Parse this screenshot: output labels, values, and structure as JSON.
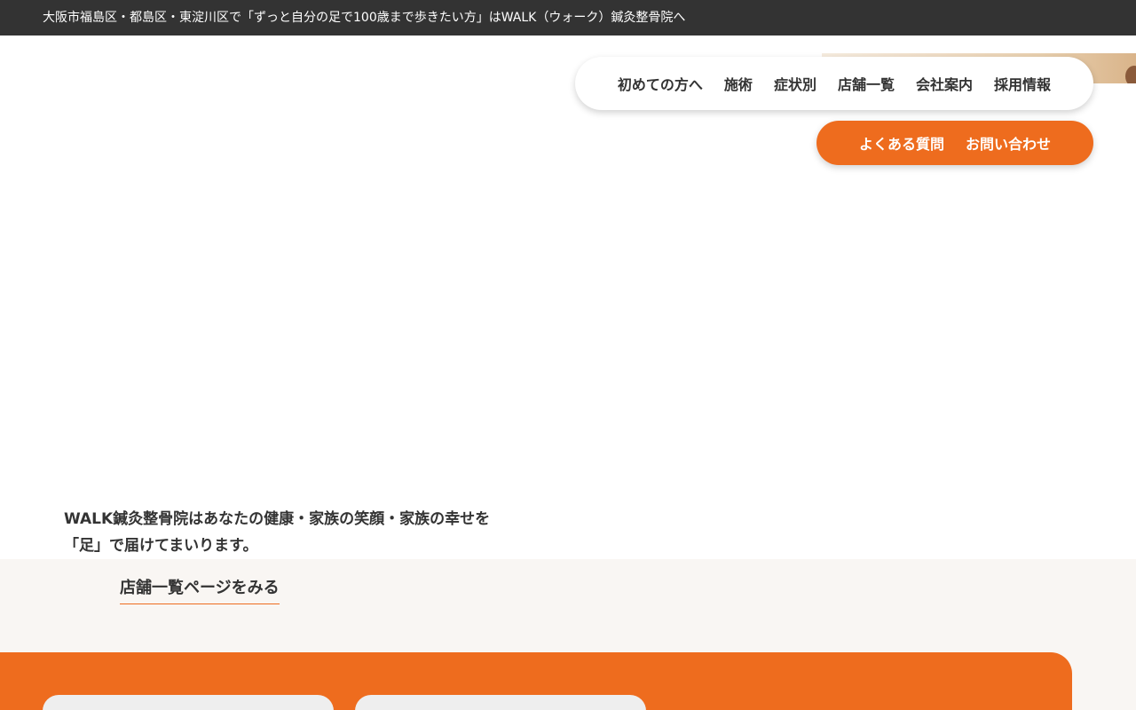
{
  "topbar": {
    "text": "大阪市福島区・都島区・東淀川区で「ずっと自分の足で100歳まで歩きたい方」はWALK（ウォーク）鍼灸整骨院へ"
  },
  "nav": {
    "items": [
      {
        "label": "初めての方へ"
      },
      {
        "label": "施術"
      },
      {
        "label": "症状別"
      },
      {
        "label": "店舗一覧"
      },
      {
        "label": "会社案内"
      },
      {
        "label": "採用情報"
      }
    ]
  },
  "cta": {
    "faq_label": "よくある質問",
    "contact_label": "お問い合わせ"
  },
  "hero": {
    "tagline_line1": "WALK鍼灸整骨院はあなたの健康・家族の笑顔・家族の幸せを",
    "tagline_line2": "「足」で届けてまいります。"
  },
  "shops": {
    "link_label": "店舗一覧ページをみる"
  },
  "colors": {
    "accent": "#ee6c1e",
    "topbar": "#333333",
    "band": "#f9f6f3"
  }
}
